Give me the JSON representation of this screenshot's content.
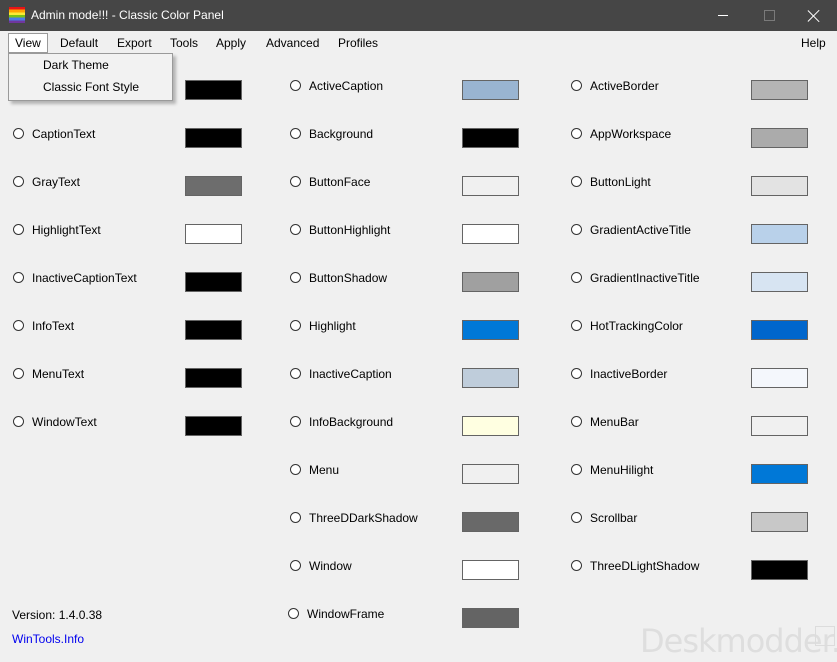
{
  "window": {
    "title": "Admin mode!!! - Classic Color Panel",
    "minimize_glyph": "",
    "close_glyph": ""
  },
  "menu": {
    "items": [
      "View",
      "Default",
      "Export",
      "Tools",
      "Apply",
      "Advanced",
      "Profiles"
    ],
    "help": "Help",
    "open_menu": "View"
  },
  "view_menu": {
    "items": [
      "Dark Theme",
      "Classic Font Style"
    ]
  },
  "columns": [
    {
      "entries": [
        {
          "name": "",
          "color": "#000000"
        },
        {
          "name": "CaptionText",
          "color": "#000000"
        },
        {
          "name": "GrayText",
          "color": "#6d6d6d"
        },
        {
          "name": "HighlightText",
          "color": "#ffffff"
        },
        {
          "name": "InactiveCaptionText",
          "color": "#000000"
        },
        {
          "name": "InfoText",
          "color": "#000000"
        },
        {
          "name": "MenuText",
          "color": "#000000"
        },
        {
          "name": "WindowText",
          "color": "#000000"
        }
      ]
    },
    {
      "entries": [
        {
          "name": "ActiveCaption",
          "color": "#99b4d1"
        },
        {
          "name": "Background",
          "color": "#000000"
        },
        {
          "name": "ButtonFace",
          "color": "#f0f0f0"
        },
        {
          "name": "ButtonHighlight",
          "color": "#ffffff"
        },
        {
          "name": "ButtonShadow",
          "color": "#a0a0a0"
        },
        {
          "name": "Highlight",
          "color": "#0078d7"
        },
        {
          "name": "InactiveCaption",
          "color": "#bfcddb"
        },
        {
          "name": "InfoBackground",
          "color": "#ffffe1"
        },
        {
          "name": "Menu",
          "color": "#f0f0f0"
        },
        {
          "name": "ThreeDDarkShadow",
          "color": "#696969"
        },
        {
          "name": "Window",
          "color": "#ffffff"
        },
        {
          "name": "WindowFrame",
          "color": "#646464"
        }
      ]
    },
    {
      "entries": [
        {
          "name": "ActiveBorder",
          "color": "#b4b4b4"
        },
        {
          "name": "AppWorkspace",
          "color": "#ababab"
        },
        {
          "name": "ButtonLight",
          "color": "#e3e3e3"
        },
        {
          "name": "GradientActiveTitle",
          "color": "#b9d1ea"
        },
        {
          "name": "GradientInactiveTitle",
          "color": "#d7e4f2"
        },
        {
          "name": "HotTrackingColor",
          "color": "#0066cc"
        },
        {
          "name": "InactiveBorder",
          "color": "#f4f7fc"
        },
        {
          "name": "MenuBar",
          "color": "#f0f0f0"
        },
        {
          "name": "MenuHilight",
          "color": "#0078d7"
        },
        {
          "name": "Scrollbar",
          "color": "#c8c8c8"
        },
        {
          "name": "ThreeDLightShadow",
          "color": "#000000"
        }
      ]
    }
  ],
  "footer": {
    "version": "Version: 1.4.0.38",
    "link": "WinTools.Info",
    "watermark": "Deskmodder.de"
  }
}
